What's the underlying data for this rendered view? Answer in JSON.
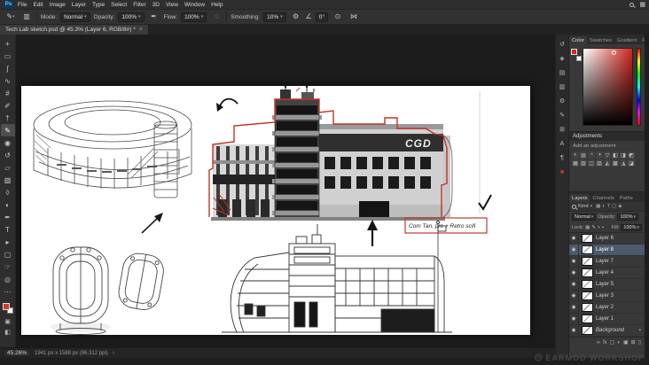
{
  "app": {
    "name": "Ps"
  },
  "menu_bar": {
    "items": [
      {
        "name": "menu-file",
        "label": "File"
      },
      {
        "name": "menu-edit",
        "label": "Edit"
      },
      {
        "name": "menu-image",
        "label": "Image"
      },
      {
        "name": "menu-layer",
        "label": "Layer"
      },
      {
        "name": "menu-type",
        "label": "Type"
      },
      {
        "name": "menu-select",
        "label": "Select"
      },
      {
        "name": "menu-filter",
        "label": "Filter"
      },
      {
        "name": "menu-3d",
        "label": "3D"
      },
      {
        "name": "menu-view",
        "label": "View"
      },
      {
        "name": "menu-window",
        "label": "Window"
      },
      {
        "name": "menu-help",
        "label": "Help"
      }
    ]
  },
  "options_bar": {
    "mode_label": "Mode:",
    "mode_value": "Normal",
    "opacity_label": "Opacity:",
    "opacity_value": "100%",
    "flow_label": "Flow:",
    "flow_value": "100%",
    "smoothing_label": "Smoothing:",
    "smoothing_value": "10%",
    "angle_value": "0°"
  },
  "document_tab": {
    "title": "Tech Lab sketch.psd @ 45.3% (Layer 6, RGB/8#) *"
  },
  "toolbar": {
    "tools": [
      {
        "name": "move-tool",
        "glyph": "+"
      },
      {
        "name": "marquee-tool",
        "glyph": "▭"
      },
      {
        "name": "lasso-tool",
        "glyph": "ʃ"
      },
      {
        "name": "quick-selection-tool",
        "glyph": "∿"
      },
      {
        "name": "crop-tool",
        "glyph": "#"
      },
      {
        "name": "eyedropper-tool",
        "glyph": "✐"
      },
      {
        "name": "healing-brush-tool",
        "glyph": "†"
      },
      {
        "name": "brush-tool",
        "glyph": "✎",
        "selected": true
      },
      {
        "name": "clone-stamp-tool",
        "glyph": "◉"
      },
      {
        "name": "history-brush-tool",
        "glyph": "↺"
      },
      {
        "name": "eraser-tool",
        "glyph": "▱"
      },
      {
        "name": "gradient-tool",
        "glyph": "▨"
      },
      {
        "name": "blur-tool",
        "glyph": "◊"
      },
      {
        "name": "dodge-tool",
        "glyph": "◐"
      },
      {
        "name": "pen-tool",
        "glyph": "✒"
      },
      {
        "name": "type-tool",
        "glyph": "T"
      },
      {
        "name": "path-selection-tool",
        "glyph": "▸"
      },
      {
        "name": "shape-tool",
        "glyph": "▢"
      },
      {
        "name": "hand-tool",
        "glyph": "☞"
      },
      {
        "name": "zoom-tool",
        "glyph": "◎"
      },
      {
        "name": "edit-toolbar",
        "glyph": "⋯"
      }
    ]
  },
  "dock_icons": [
    {
      "name": "dock-history-icon",
      "glyph": "↺"
    },
    {
      "name": "dock-navigator-icon",
      "glyph": "◈"
    },
    {
      "name": "dock-histogram-icon",
      "glyph": "▤"
    },
    {
      "name": "dock-info-icon",
      "glyph": "▥"
    },
    {
      "name": "dock-properties-icon",
      "glyph": "⚙"
    },
    {
      "name": "dock-brush-settings-icon",
      "glyph": "✎"
    },
    {
      "name": "dock-clone-source-icon",
      "glyph": "⊞"
    },
    {
      "name": "dock-character-icon",
      "glyph": "A"
    },
    {
      "name": "dock-paragraph-icon",
      "glyph": "¶"
    },
    {
      "name": "dock-color-swatch-icon",
      "glyph": "■"
    }
  ],
  "panels": {
    "color": {
      "tabs": [
        {
          "name": "tab-color",
          "label": "Color",
          "active": true
        },
        {
          "name": "tab-swatches",
          "label": "Swatches"
        },
        {
          "name": "tab-gradient",
          "label": "Gradient"
        },
        {
          "name": "tab-patterns",
          "label": "Patterns"
        }
      ]
    },
    "adjustments": {
      "title": "Adjustments",
      "subtitle": "Add an adjustment",
      "icons": [
        {
          "name": "adj-brightness-contrast-icon",
          "glyph": "◐"
        },
        {
          "name": "adj-levels-icon",
          "glyph": "▤"
        },
        {
          "name": "adj-curves-icon",
          "glyph": "◔"
        },
        {
          "name": "adj-exposure-icon",
          "glyph": "◑"
        },
        {
          "name": "adj-vibrance-icon",
          "glyph": "▽"
        },
        {
          "name": "adj-hue-saturation-icon",
          "glyph": "◧"
        },
        {
          "name": "adj-color-balance-icon",
          "glyph": "◨"
        },
        {
          "name": "adj-black-white-icon",
          "glyph": "◩"
        },
        {
          "name": "adj-photo-filter-icon",
          "glyph": "▦"
        },
        {
          "name": "adj-channel-mixer-icon",
          "glyph": "▧"
        },
        {
          "name": "adj-color-lookup-icon",
          "glyph": "◫"
        },
        {
          "name": "adj-invert-icon",
          "glyph": "▨"
        },
        {
          "name": "adj-posterize-icon",
          "glyph": "◭"
        },
        {
          "name": "adj-threshold-icon",
          "glyph": "▩"
        },
        {
          "name": "adj-gradient-map-icon",
          "glyph": "◮"
        },
        {
          "name": "adj-selective-color-icon",
          "glyph": "◪"
        }
      ]
    },
    "layers": {
      "tabs": [
        {
          "name": "tab-layers",
          "label": "Layers",
          "active": true
        },
        {
          "name": "tab-channels",
          "label": "Channels"
        },
        {
          "name": "tab-paths",
          "label": "Paths"
        }
      ],
      "filter_label": "Kind",
      "filter_icons": [
        {
          "name": "filter-pixel-layers-icon",
          "glyph": "▦"
        },
        {
          "name": "filter-adjustment-layers-icon",
          "glyph": "◐"
        },
        {
          "name": "filter-type-layers-icon",
          "glyph": "T"
        },
        {
          "name": "filter-shape-layers-icon",
          "glyph": "▢"
        },
        {
          "name": "filter-smart-objects-icon",
          "glyph": "◈"
        }
      ],
      "blend_mode": "Normal",
      "opacity_label": "Opacity:",
      "opacity_value": "100%",
      "lock_label": "Lock:",
      "lock_icons": [
        {
          "name": "lock-transparent-pixels-icon",
          "glyph": "▦"
        },
        {
          "name": "lock-image-pixels-icon",
          "glyph": "✎"
        },
        {
          "name": "lock-position-icon",
          "glyph": "+"
        },
        {
          "name": "lock-all-icon",
          "glyph": "▪"
        }
      ],
      "fill_label": "Fill:",
      "fill_value": "100%",
      "rows": [
        {
          "name": "Layer 6"
        },
        {
          "name": "Layer 8",
          "selected": true
        },
        {
          "name": "Layer 7"
        },
        {
          "name": "Layer 4"
        },
        {
          "name": "Layer 5"
        },
        {
          "name": "Layer 3"
        },
        {
          "name": "Layer 2"
        },
        {
          "name": "Layer 1"
        },
        {
          "name": "Background",
          "locked": true
        }
      ],
      "footer_icons": [
        {
          "name": "link-layers-icon",
          "glyph": "∞"
        },
        {
          "name": "layer-style-icon",
          "glyph": "fx"
        },
        {
          "name": "add-mask-icon",
          "glyph": "▢"
        },
        {
          "name": "new-adjustment-layer-icon",
          "glyph": "◐"
        },
        {
          "name": "new-group-icon",
          "glyph": "▣"
        },
        {
          "name": "new-layer-icon",
          "glyph": "⊞"
        },
        {
          "name": "delete-layer-icon",
          "glyph": "▯"
        }
      ]
    }
  },
  "canvas": {
    "building_label": "CGD",
    "annotation": "Com Tan, pre + Retro scifi"
  },
  "status_bar": {
    "zoom": "45.26%",
    "info": "1941 px x 1588 px (96.312 ppi)"
  },
  "watermark": {
    "text": "EARMOD WORKSHOP"
  },
  "icons": {
    "caret": "▾",
    "brush_preset": "✎",
    "panel_toggle": "▥",
    "pressure": "✒",
    "airbrush": "◌",
    "gear": "⚙",
    "angle": "∠",
    "pressure_size": "⊙",
    "symmetry": "⋈",
    "workspace": "▦",
    "close": "×",
    "chevron": "›",
    "eye": "◉",
    "layer_lock": "▪",
    "watermark_gear": "⚙"
  },
  "colors": {
    "accent_red": "#c0392b",
    "foreground_color": "#d6261d",
    "layer_selection": "#4b5a6a",
    "ui_dark": "#1e1e1e",
    "ui_panel": "#383838"
  }
}
